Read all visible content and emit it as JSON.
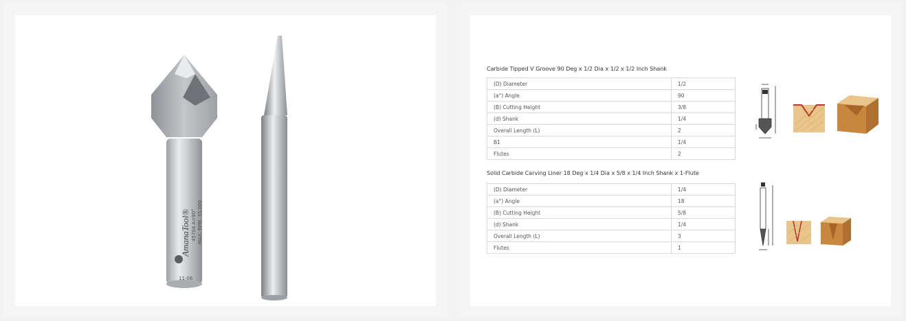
{
  "product_photo": {
    "shank_marking_line1": "AmanaTool®",
    "shank_marking_line2": "45704  A=90°",
    "shank_marking_line3": "MAX. RPM. 35,000",
    "shank_code": "11-06"
  },
  "spec_sections": [
    {
      "title": "Carbide Tipped V Groove 90 Deg x 1/2 Dia x 1/2 x 1/2 Inch Shank",
      "rows": [
        {
          "label": "(D) Diameter",
          "value": "1/2"
        },
        {
          "label": "(a°) Angle",
          "value": "90"
        },
        {
          "label": "(B) Cutting Height",
          "value": "3/8"
        },
        {
          "label": "(d) Shank",
          "value": "1/4"
        },
        {
          "label": "Overall Length (L)",
          "value": "2"
        },
        {
          "label": "B1",
          "value": "1/4"
        },
        {
          "label": "Flutes",
          "value": "2"
        }
      ]
    },
    {
      "title": "Solid Carbide Carving Liner 18 Deg x 1/4 Dia x 5/8 x 1/4 Inch Shank x 1-Flute",
      "rows": [
        {
          "label": "(D) Diameter",
          "value": "1/4"
        },
        {
          "label": "(a°) Angle",
          "value": "18"
        },
        {
          "label": "(B) Cutting Height",
          "value": "5/8"
        },
        {
          "label": "(d) Shank",
          "value": "1/4"
        },
        {
          "label": "Overall Length (L)",
          "value": "3"
        },
        {
          "label": "Flutes",
          "value": "1"
        }
      ]
    }
  ],
  "colors": {
    "wood_light": "#e9c48b",
    "wood_dark": "#c8873f",
    "steel": "#b9bcbf"
  }
}
